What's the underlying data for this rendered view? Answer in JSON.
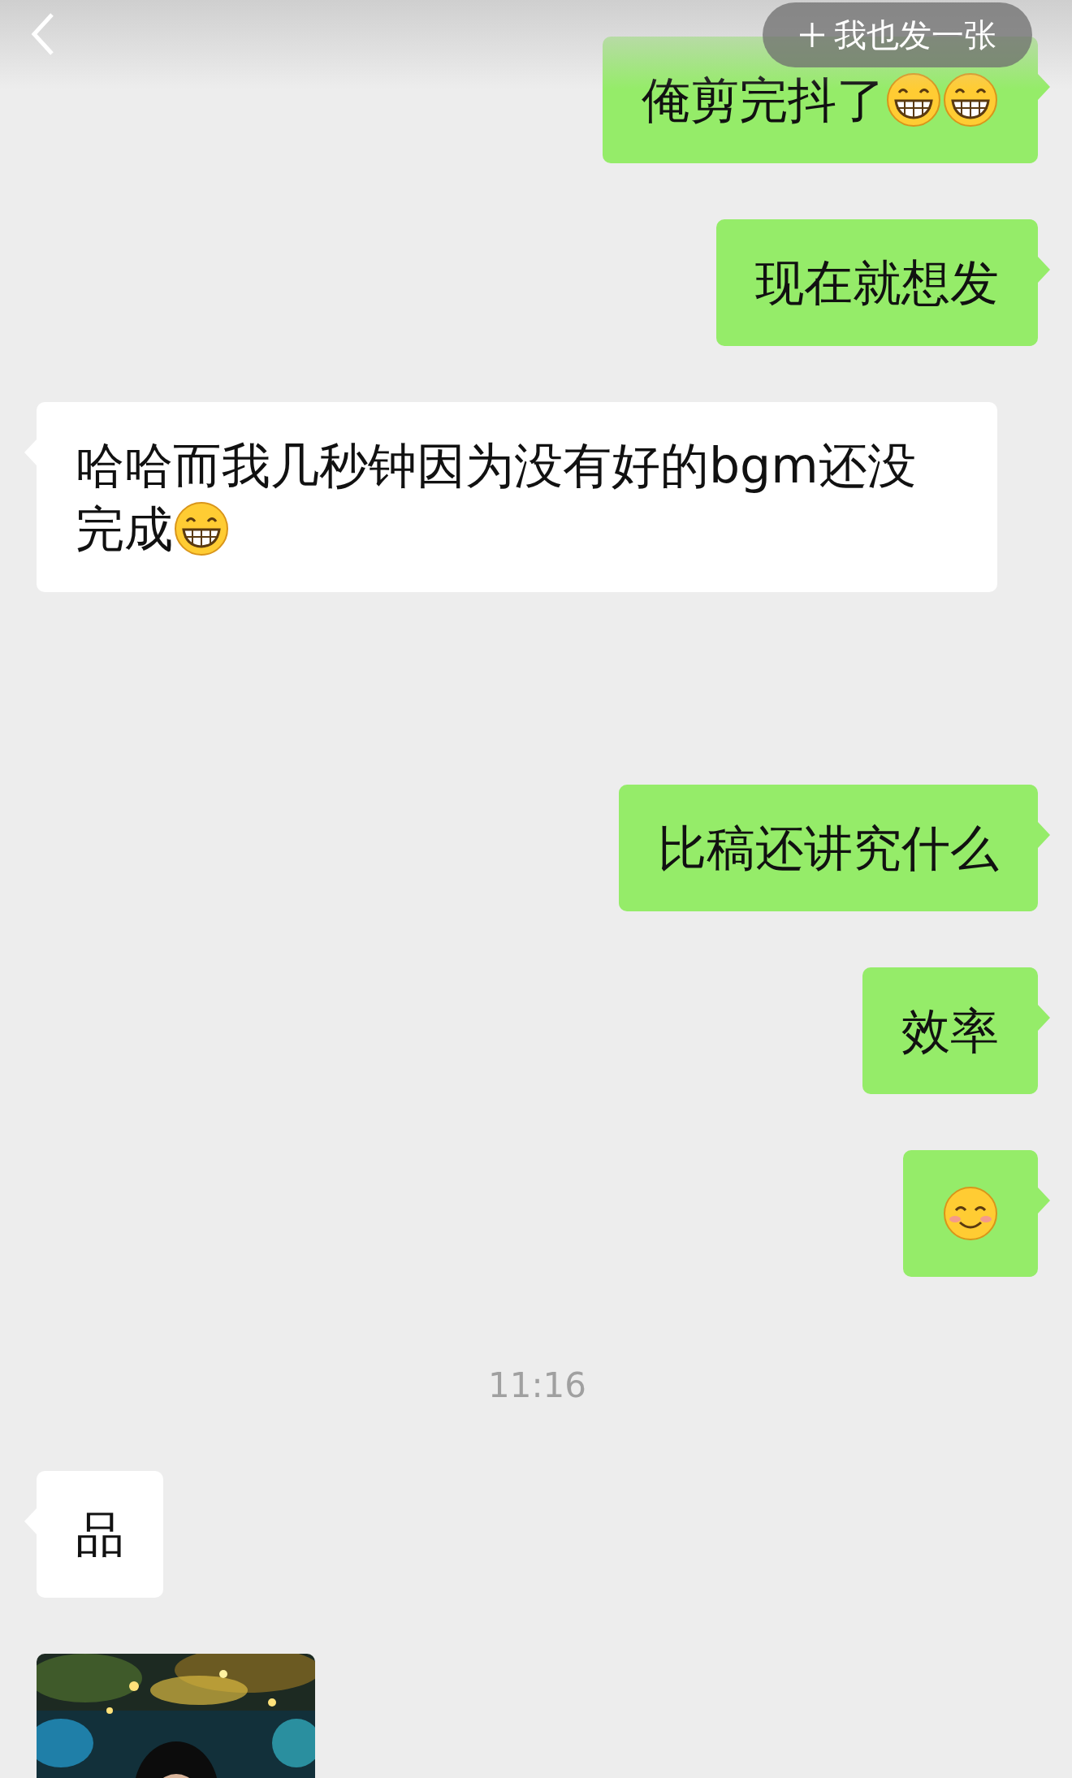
{
  "header": {
    "action": "我也发一张"
  },
  "messages": [
    {
      "kind": "bubble",
      "outgoing": true,
      "parts": [
        {
          "kind": "text",
          "text": "俺剪完抖了"
        },
        {
          "kind": "grin"
        },
        {
          "kind": "grin"
        }
      ]
    },
    {
      "kind": "bubble",
      "outgoing": true,
      "parts": [
        {
          "kind": "text",
          "text": "现在就想发"
        }
      ]
    },
    {
      "kind": "bubble",
      "outgoing": false,
      "parts": [
        {
          "kind": "text",
          "text": "哈哈而我几秒钟因为没有好的bgm还没完成"
        },
        {
          "kind": "grin"
        }
      ]
    },
    {
      "kind": "bubble",
      "outgoing": true,
      "parts": [
        {
          "kind": "text",
          "text": "比稿还讲究什么"
        }
      ]
    },
    {
      "kind": "bubble",
      "outgoing": true,
      "parts": [
        {
          "kind": "text",
          "text": "效率"
        }
      ]
    },
    {
      "kind": "bubble",
      "outgoing": true,
      "parts": [
        {
          "kind": "smile"
        }
      ]
    },
    {
      "kind": "time",
      "text": "11:16"
    },
    {
      "kind": "bubble",
      "outgoing": false,
      "parts": [
        {
          "kind": "text",
          "text": "品"
        }
      ]
    },
    {
      "kind": "picture",
      "outgoing": false
    }
  ]
}
